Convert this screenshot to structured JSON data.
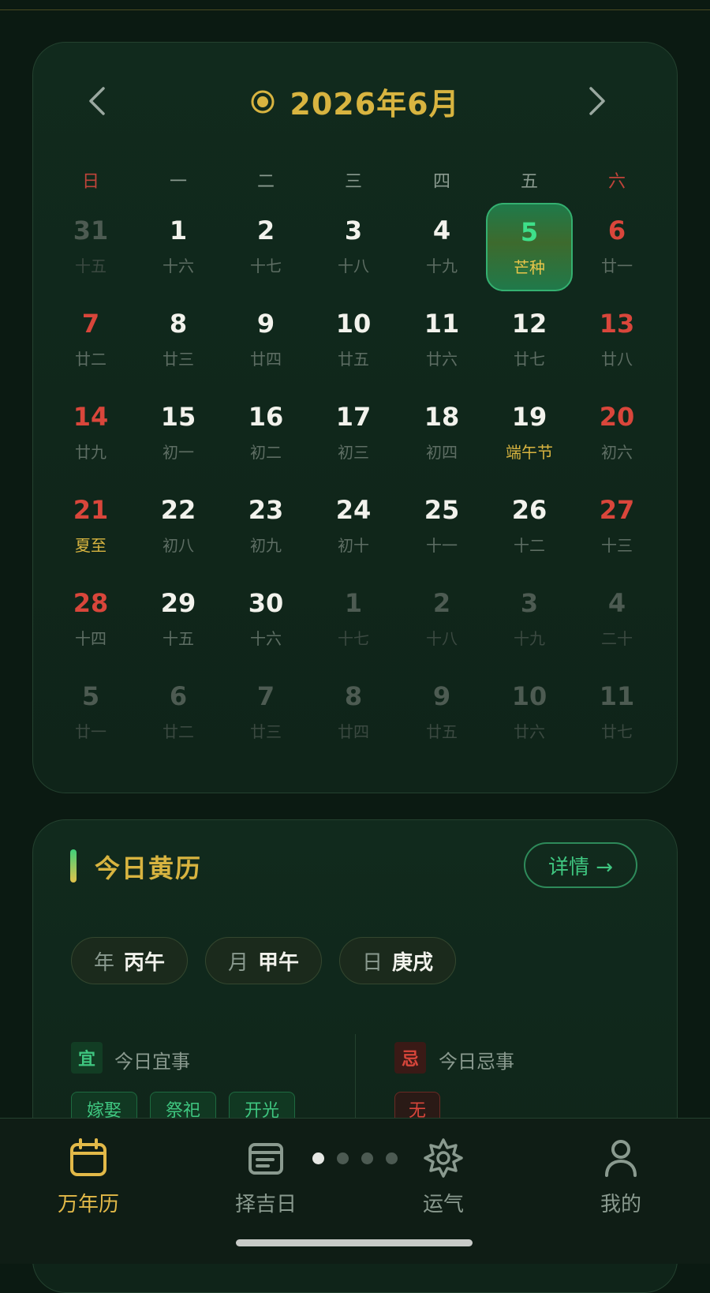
{
  "calendar": {
    "title": "2026年6月",
    "weekdays": [
      "日",
      "一",
      "二",
      "三",
      "四",
      "五",
      "六"
    ],
    "weeks": [
      [
        {
          "n": "31",
          "l": "十五",
          "dim": true
        },
        {
          "n": "1",
          "l": "十六"
        },
        {
          "n": "2",
          "l": "十七"
        },
        {
          "n": "3",
          "l": "十八"
        },
        {
          "n": "4",
          "l": "十九"
        },
        {
          "n": "5",
          "l": "芒种",
          "sel": true
        },
        {
          "n": "6",
          "l": "廿一",
          "red": true
        }
      ],
      [
        {
          "n": "7",
          "l": "廿二",
          "red": true
        },
        {
          "n": "8",
          "l": "廿三"
        },
        {
          "n": "9",
          "l": "廿四"
        },
        {
          "n": "10",
          "l": "廿五"
        },
        {
          "n": "11",
          "l": "廿六"
        },
        {
          "n": "12",
          "l": "廿七"
        },
        {
          "n": "13",
          "l": "廿八",
          "red": true
        }
      ],
      [
        {
          "n": "14",
          "l": "廿九",
          "red": true
        },
        {
          "n": "15",
          "l": "初一"
        },
        {
          "n": "16",
          "l": "初二"
        },
        {
          "n": "17",
          "l": "初三"
        },
        {
          "n": "18",
          "l": "初四"
        },
        {
          "n": "19",
          "l": "端午节",
          "term": true
        },
        {
          "n": "20",
          "l": "初六",
          "red": true
        }
      ],
      [
        {
          "n": "21",
          "l": "夏至",
          "red": true,
          "term": true
        },
        {
          "n": "22",
          "l": "初八"
        },
        {
          "n": "23",
          "l": "初九"
        },
        {
          "n": "24",
          "l": "初十"
        },
        {
          "n": "25",
          "l": "十一"
        },
        {
          "n": "26",
          "l": "十二"
        },
        {
          "n": "27",
          "l": "十三",
          "red": true
        }
      ],
      [
        {
          "n": "28",
          "l": "十四",
          "red": true
        },
        {
          "n": "29",
          "l": "十五"
        },
        {
          "n": "30",
          "l": "十六"
        },
        {
          "n": "1",
          "l": "十七",
          "dim": true
        },
        {
          "n": "2",
          "l": "十八",
          "dim": true
        },
        {
          "n": "3",
          "l": "十九",
          "dim": true
        },
        {
          "n": "4",
          "l": "二十",
          "dim": true
        }
      ],
      [
        {
          "n": "5",
          "l": "廿一",
          "dim": true
        },
        {
          "n": "6",
          "l": "廿二",
          "dim": true
        },
        {
          "n": "7",
          "l": "廿三",
          "dim": true
        },
        {
          "n": "8",
          "l": "廿四",
          "dim": true
        },
        {
          "n": "9",
          "l": "廿五",
          "dim": true
        },
        {
          "n": "10",
          "l": "廿六",
          "dim": true
        },
        {
          "n": "11",
          "l": "廿七",
          "dim": true
        }
      ]
    ]
  },
  "almanac": {
    "title": "今日黄历",
    "detail_label": "详情 →",
    "ganzhi": [
      {
        "k": "年",
        "v": "丙午"
      },
      {
        "k": "月",
        "v": "甲午"
      },
      {
        "k": "日",
        "v": "庚戌"
      }
    ],
    "yi_badge": "宜",
    "yi_label": "今日宜事",
    "yi_items": [
      "嫁娶",
      "祭祀",
      "开光"
    ],
    "ji_badge": "忌",
    "ji_label": "今日忌事",
    "ji_items": [
      "无"
    ]
  },
  "bottom_nav": [
    {
      "label": "万年历",
      "icon": "calendar-icon",
      "active": true
    },
    {
      "label": "择吉日",
      "icon": "calendar-select-icon"
    },
    {
      "label": "运气",
      "icon": "sun-gear-icon"
    },
    {
      "label": "我的",
      "icon": "person-icon"
    }
  ],
  "colors": {
    "accent_gold": "#d8b440",
    "accent_green": "#3fc680",
    "red": "#d9463b"
  }
}
